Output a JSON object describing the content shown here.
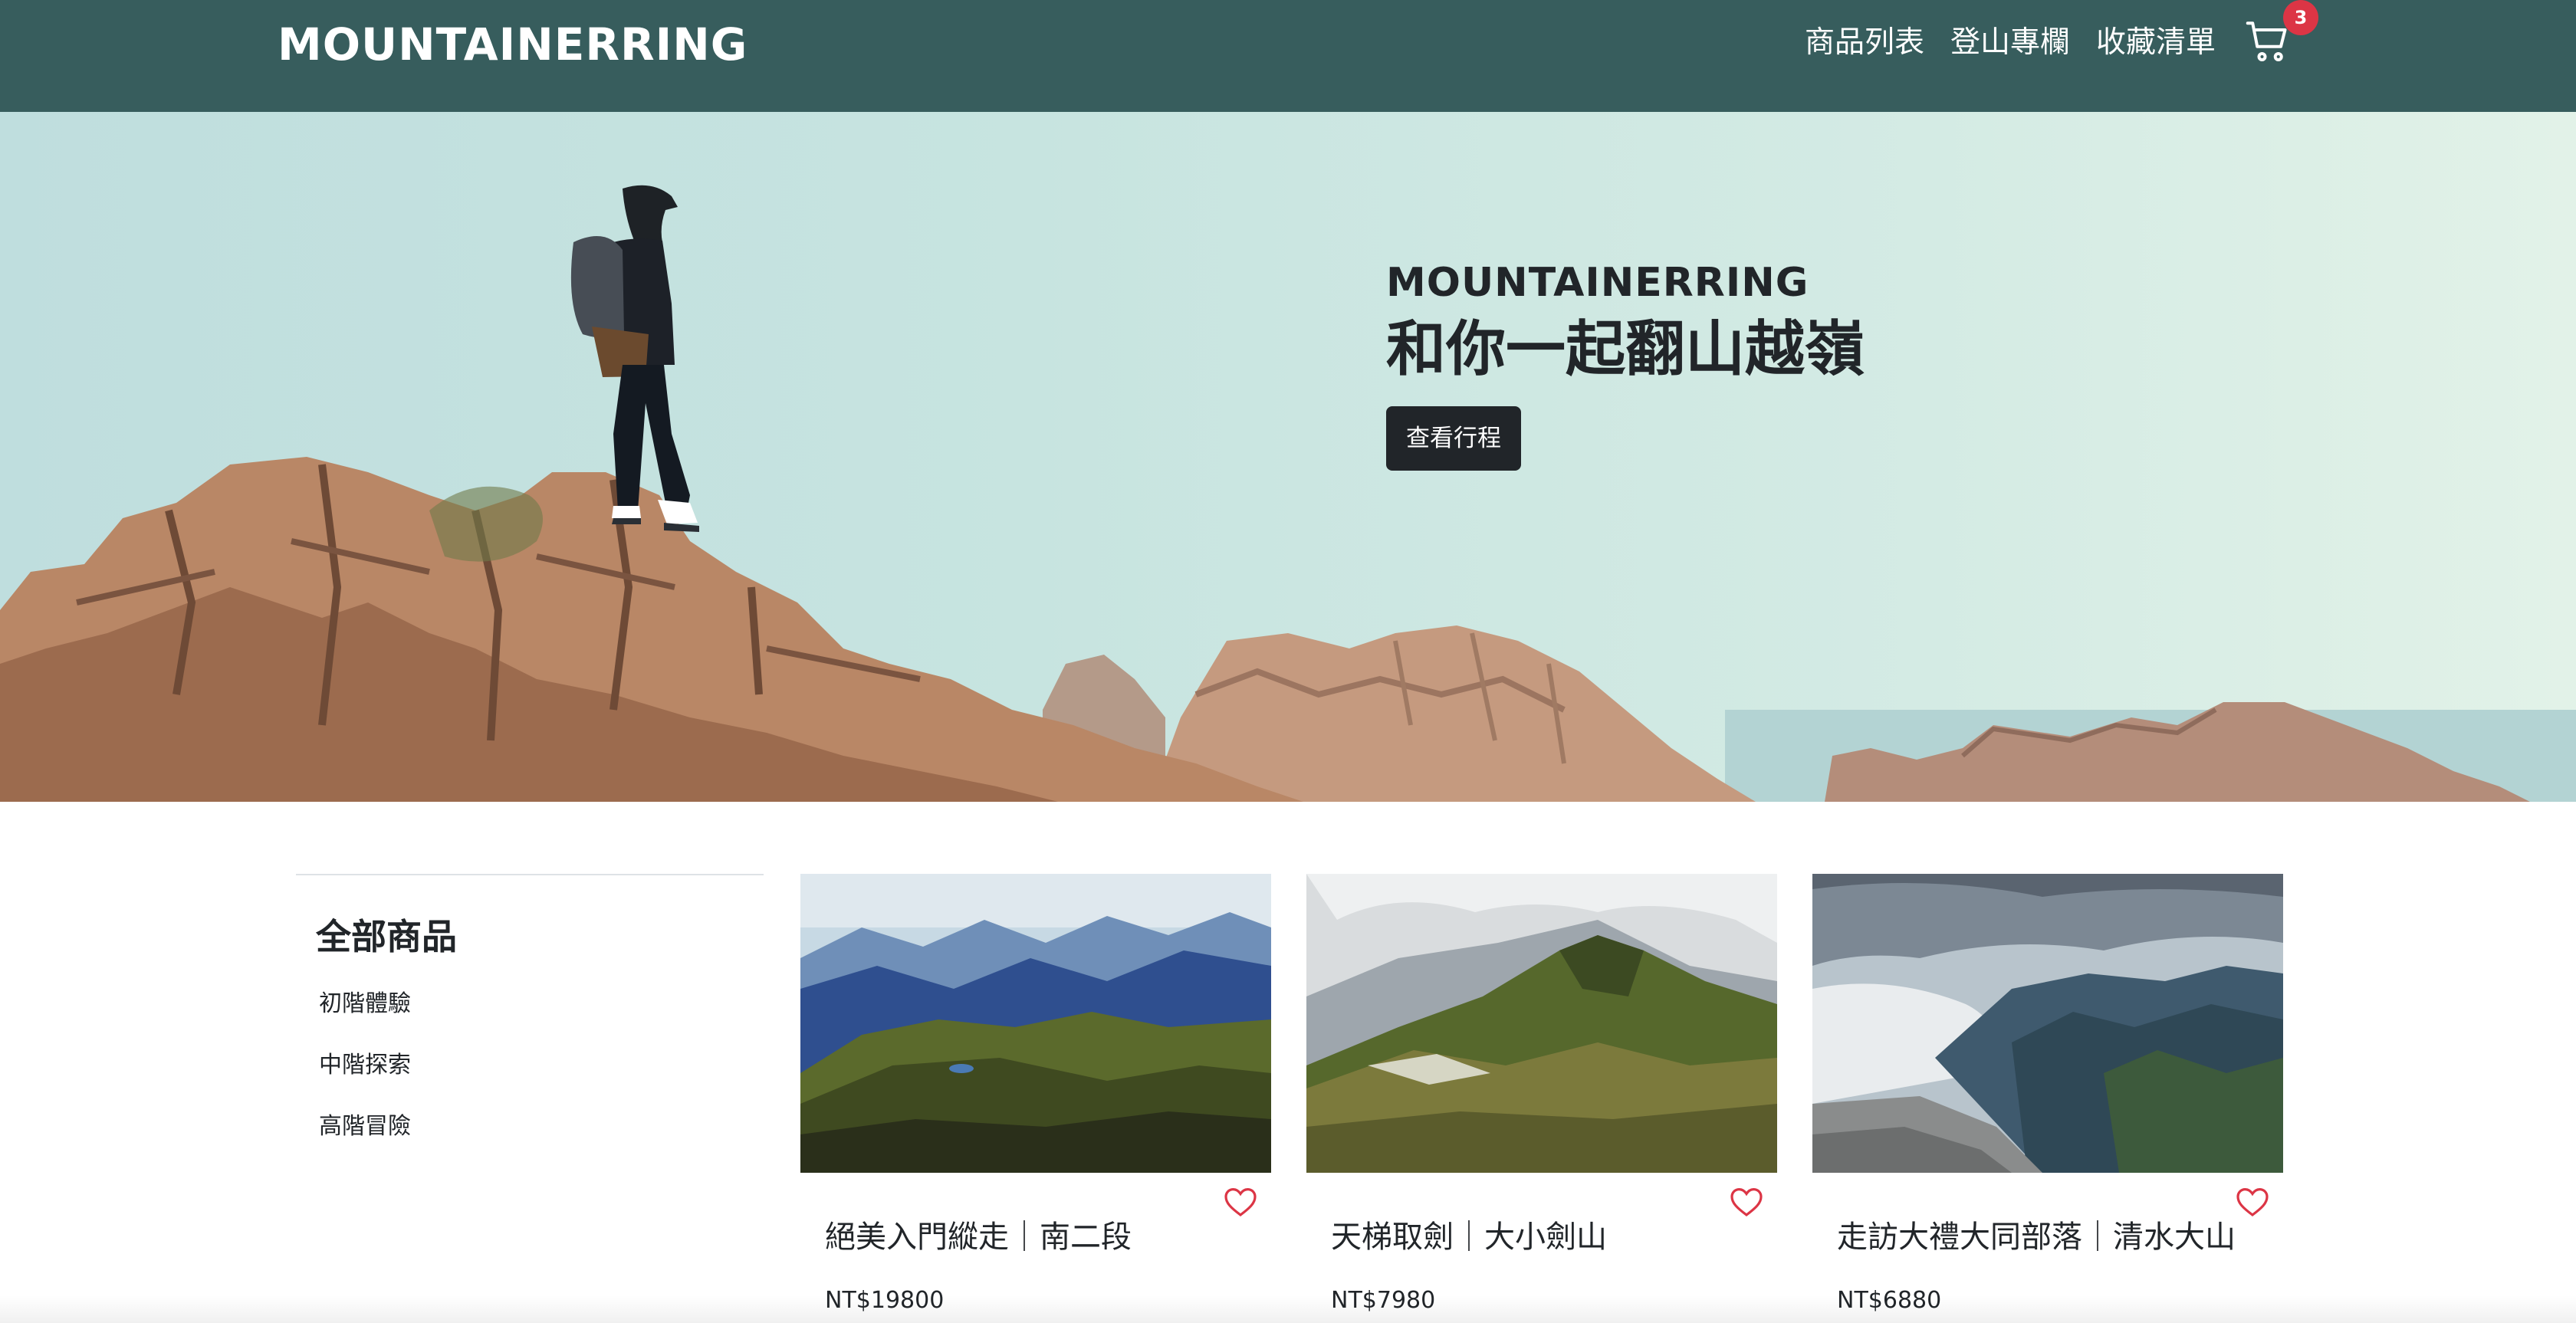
{
  "navbar": {
    "brand": "MOUNTAINERRING",
    "links": [
      "商品列表",
      "登山專欄",
      "收藏清單"
    ],
    "cart_count": "3",
    "colors": {
      "background": "#375d5d",
      "badge": "#dc3545"
    }
  },
  "hero": {
    "subtitle": "MOUNTAINERRING",
    "title": "和你一起翻山越嶺",
    "button_label": "查看行程"
  },
  "sidebar": {
    "title": "全部商品",
    "items": [
      "初階體驗",
      "中階探索",
      "高階冒險"
    ]
  },
  "products": [
    {
      "title": "絕美入門縱走｜南二段",
      "price": "NT$19800",
      "favorite_icon": "heart-outline-icon"
    },
    {
      "title": "天梯取劍｜大小劍山",
      "price": "NT$7980",
      "favorite_icon": "heart-outline-icon"
    },
    {
      "title": "走訪大禮大同部落｜清水大山",
      "price": "NT$6880",
      "favorite_icon": "heart-outline-icon"
    }
  ],
  "accent_colors": {
    "favorite": "#dc3545",
    "button": "#212529"
  }
}
